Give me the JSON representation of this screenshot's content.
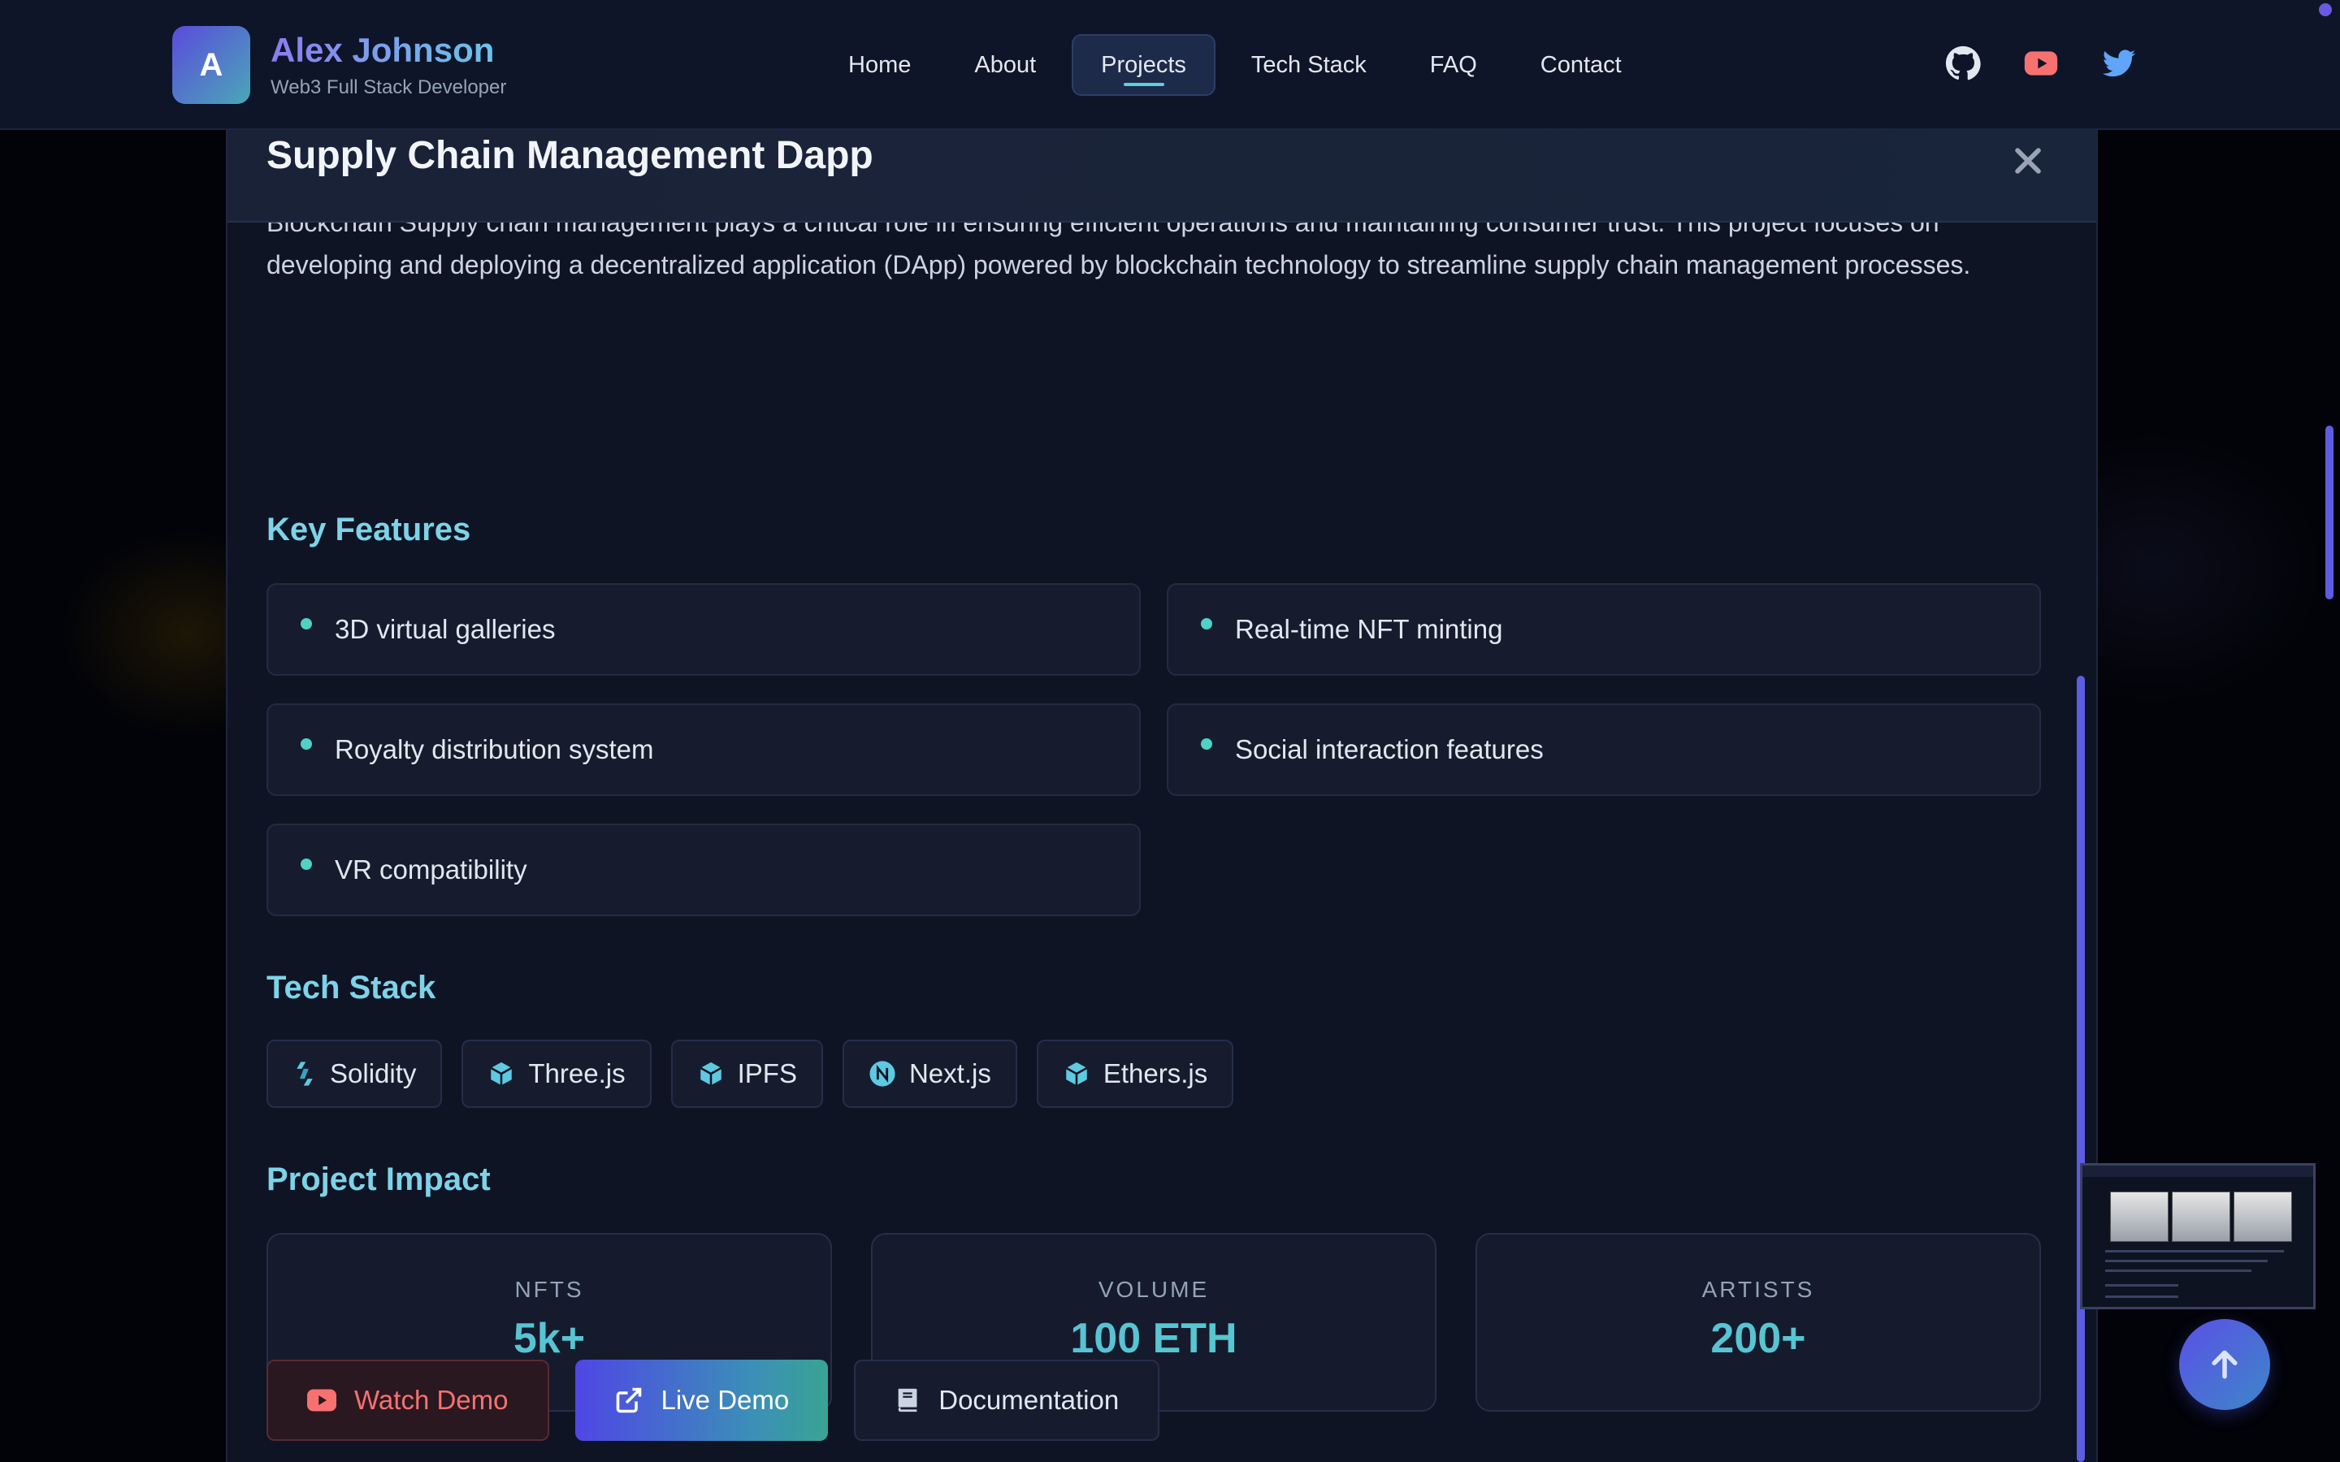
{
  "header": {
    "logo_letter": "A",
    "name": "Alex Johnson",
    "subtitle": "Web3 Full Stack Developer",
    "nav": [
      {
        "label": "Home",
        "active": false
      },
      {
        "label": "About",
        "active": false
      },
      {
        "label": "Projects",
        "active": true
      },
      {
        "label": "Tech Stack",
        "active": false
      },
      {
        "label": "FAQ",
        "active": false
      },
      {
        "label": "Contact",
        "active": false
      }
    ],
    "social_icons": [
      "github-icon",
      "youtube-icon",
      "twitter-icon"
    ]
  },
  "modal": {
    "title": "Supply Chain Management Dapp",
    "description": "Blockchain Supply chain management plays a critical role in ensuring efficient operations and maintaining consumer trust. This project focuses on developing and deploying a decentralized application (DApp) powered by blockchain technology to streamline supply chain management processes.",
    "features_title": "Key Features",
    "features": [
      "3D virtual galleries",
      "Real-time NFT minting",
      "Royalty distribution system",
      "Social interaction features",
      "VR compatibility"
    ],
    "tech_title": "Tech Stack",
    "tech": [
      {
        "label": "Solidity",
        "icon": "solidity-icon"
      },
      {
        "label": "Three.js",
        "icon": "cube-icon"
      },
      {
        "label": "IPFS",
        "icon": "cube-icon"
      },
      {
        "label": "Next.js",
        "icon": "nextjs-icon"
      },
      {
        "label": "Ethers.js",
        "icon": "cube-icon"
      }
    ],
    "impact_title": "Project Impact",
    "stats": [
      {
        "label": "NFTS",
        "value": "5k+"
      },
      {
        "label": "VOLUME",
        "value": "100 ETH"
      },
      {
        "label": "ARTISTS",
        "value": "200+"
      }
    ],
    "buttons": {
      "watch": "Watch Demo",
      "live": "Live Demo",
      "docs": "Documentation"
    }
  },
  "colors": {
    "accent": "#7dd3e8",
    "teal": "#4fd1c5",
    "primary": "#4f46e5",
    "background": "#0f1424"
  }
}
